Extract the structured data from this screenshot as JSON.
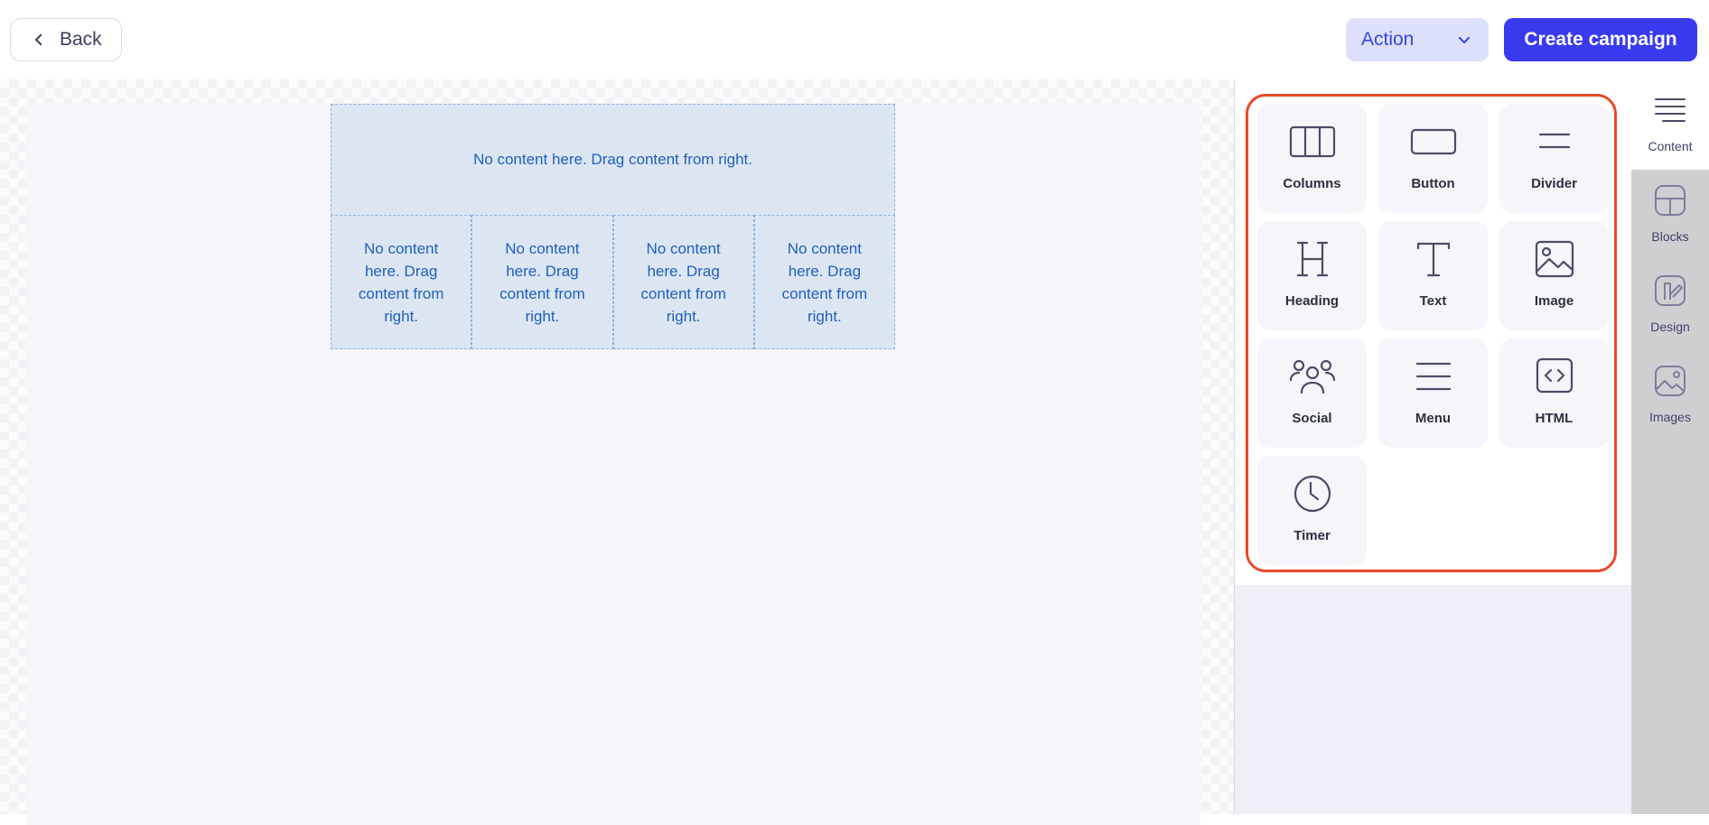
{
  "header": {
    "back_label": "Back",
    "action_label": "Action",
    "create_label": "Create campaign"
  },
  "canvas": {
    "full_row_placeholder": "No content here. Drag content from right.",
    "columns": [
      "No content here. Drag content from right.",
      "No content here. Drag content from right.",
      "No content here. Drag content from right.",
      "No content here. Drag content from right."
    ]
  },
  "tools": [
    {
      "label": "Columns",
      "icon": "columns-icon"
    },
    {
      "label": "Button",
      "icon": "button-icon"
    },
    {
      "label": "Divider",
      "icon": "divider-icon"
    },
    {
      "label": "Heading",
      "icon": "heading-icon"
    },
    {
      "label": "Text",
      "icon": "text-icon"
    },
    {
      "label": "Image",
      "icon": "image-icon"
    },
    {
      "label": "Social",
      "icon": "social-icon"
    },
    {
      "label": "Menu",
      "icon": "menu-icon"
    },
    {
      "label": "HTML",
      "icon": "html-icon"
    },
    {
      "label": "Timer",
      "icon": "timer-icon"
    }
  ],
  "side_tabs": [
    {
      "label": "Content",
      "icon": "content-icon",
      "active": true
    },
    {
      "label": "Blocks",
      "icon": "blocks-icon",
      "active": false
    },
    {
      "label": "Design",
      "icon": "design-icon",
      "active": false
    },
    {
      "label": "Images",
      "icon": "images-icon",
      "active": false
    }
  ],
  "colors": {
    "primary": "#3a3af0",
    "action_bg": "#dde0fb",
    "highlight_frame": "#e8492a",
    "placeholder_text": "#1f5fbf"
  }
}
